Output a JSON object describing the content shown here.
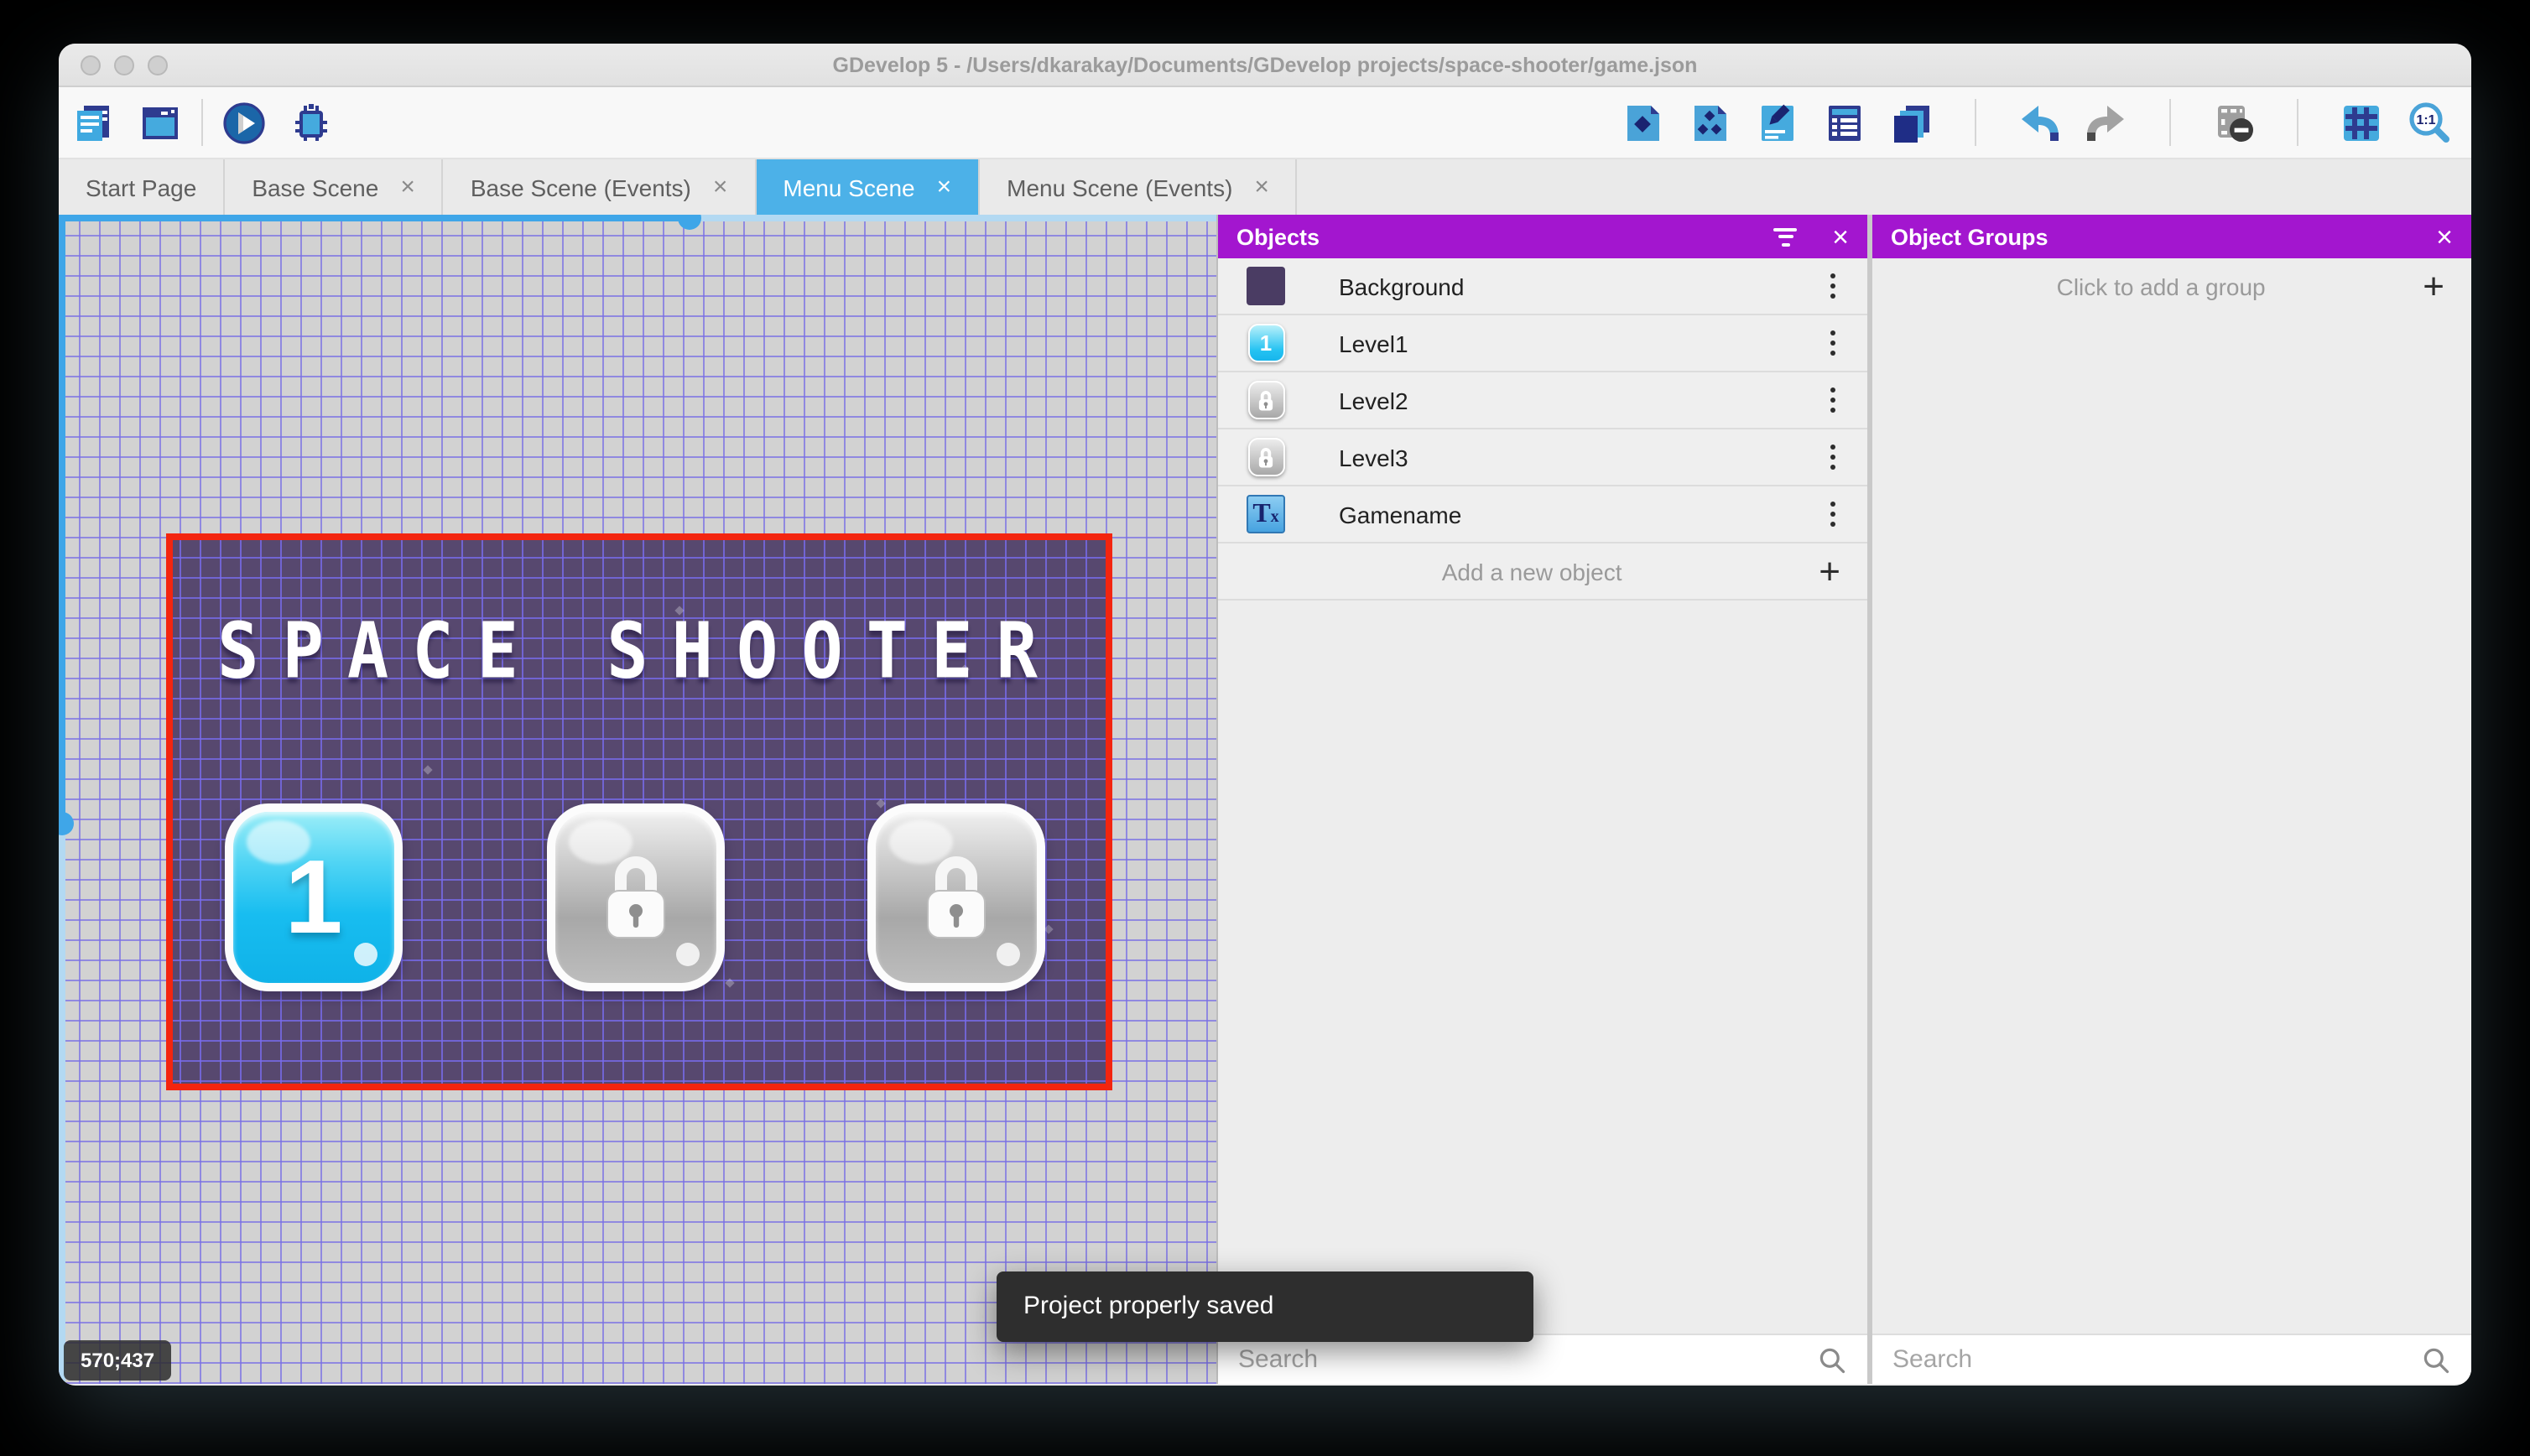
{
  "window": {
    "title": "GDevelop 5 - /Users/dkarakay/Documents/GDevelop projects/space-shooter/game.json"
  },
  "toolbar": {
    "left_icons": [
      "project-manager-icon",
      "scene-editor-icon",
      "play-icon",
      "debug-icon"
    ],
    "right_icons": [
      "objects-panel-icon",
      "object-groups-panel-icon",
      "properties-icon",
      "instances-list-icon",
      "layers-icon",
      "undo-icon",
      "redo-icon",
      "mask-toggle-icon",
      "grid-toggle-icon",
      "zoom-1-1-icon"
    ],
    "zoom_ratio": "1:1"
  },
  "tabs": [
    {
      "label": "Start Page",
      "closable": false,
      "active": false
    },
    {
      "label": "Base Scene",
      "closable": true,
      "active": false
    },
    {
      "label": "Base Scene (Events)",
      "closable": true,
      "active": false
    },
    {
      "label": "Menu Scene",
      "closable": true,
      "active": true
    },
    {
      "label": "Menu Scene (Events)",
      "closable": true,
      "active": false
    }
  ],
  "tab_close_glyph": "×",
  "canvas": {
    "coordinates": "570;437",
    "scene": {
      "title": "SPACE SHOOTER",
      "buttons": [
        {
          "name": "Level1",
          "label": "1",
          "state": "unlocked"
        },
        {
          "name": "Level2",
          "label": "lock-icon",
          "state": "locked"
        },
        {
          "name": "Level3",
          "label": "lock-icon",
          "state": "locked"
        }
      ]
    }
  },
  "objects_panel": {
    "title": "Objects",
    "items": [
      {
        "name": "Background",
        "thumb": "background-thumb"
      },
      {
        "name": "Level1",
        "thumb": "level-button-thumb",
        "thumb_text": "1"
      },
      {
        "name": "Level2",
        "thumb": "lock-button-thumb"
      },
      {
        "name": "Level3",
        "thumb": "lock-button-thumb"
      },
      {
        "name": "Gamename",
        "thumb": "text-object-thumb",
        "thumb_text_main": "T",
        "thumb_text_sub": "x"
      }
    ],
    "add_label": "Add a new object",
    "search_placeholder": "Search"
  },
  "object_groups_panel": {
    "title": "Object Groups",
    "add_label": "Click to add a group",
    "search_placeholder": "Search"
  },
  "toast": {
    "message": "Project properly saved"
  },
  "colors": {
    "accent_purple": "#a316cf",
    "accent_blue": "#4cb1e8",
    "selection_red": "#f3250f",
    "scene_bg": "#57486f"
  }
}
